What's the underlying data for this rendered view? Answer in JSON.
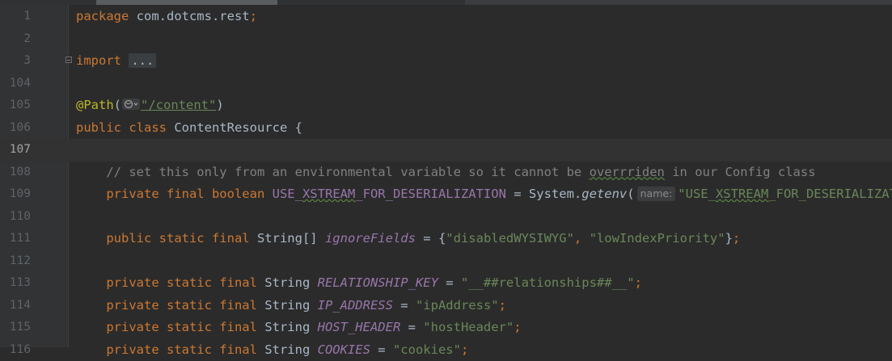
{
  "editor": {
    "lines": [
      {
        "num": "1",
        "tokens": [
          {
            "cls": "kw",
            "t": "package "
          },
          {
            "cls": "punct",
            "t": "com.dotcms.rest"
          },
          {
            "cls": "kw",
            "t": ";"
          }
        ]
      },
      {
        "num": "2",
        "tokens": []
      },
      {
        "num": "3",
        "fold": true,
        "tokens": [
          {
            "cls": "kw",
            "t": "import "
          },
          {
            "cls": "folded",
            "t": "..."
          }
        ]
      },
      {
        "num": "104",
        "tokens": []
      },
      {
        "num": "105",
        "tokens": [
          {
            "cls": "anno",
            "t": "@Path"
          },
          {
            "cls": "punct",
            "t": "("
          },
          {
            "cls": "globe-hint",
            "t": ""
          },
          {
            "cls": "str ul",
            "t": "\"/content\""
          },
          {
            "cls": "punct",
            "t": ")"
          }
        ]
      },
      {
        "num": "106",
        "tokens": [
          {
            "cls": "kw",
            "t": "public class "
          },
          {
            "cls": "punct",
            "t": "ContentResource {"
          }
        ]
      },
      {
        "num": "107",
        "current": true,
        "tokens": []
      },
      {
        "num": "108",
        "tokens": [
          {
            "cls": "comment",
            "t": "    // set this only from an environmental variable so it cannot be "
          },
          {
            "cls": "comment squiggle",
            "t": "overrriden"
          },
          {
            "cls": "comment",
            "t": " in our Config class"
          }
        ]
      },
      {
        "num": "109",
        "tokens": [
          {
            "cls": "kw",
            "t": "    private final boolean "
          },
          {
            "cls": "field",
            "t": "USE_"
          },
          {
            "cls": "field squiggle",
            "t": "XSTREAM"
          },
          {
            "cls": "field",
            "t": "_FOR_DESERIALIZATION"
          },
          {
            "cls": "punct",
            "t": " = System."
          },
          {
            "cls": "method",
            "t": "getenv"
          },
          {
            "cls": "punct",
            "t": "("
          },
          {
            "cls": "hint",
            "t": "name:"
          },
          {
            "cls": "str",
            "t": "\"USE_"
          },
          {
            "cls": "str squiggle",
            "t": "XSTREAM"
          },
          {
            "cls": "str",
            "t": "_FOR_DESERIALIZATION\""
          }
        ]
      },
      {
        "num": "110",
        "tokens": []
      },
      {
        "num": "111",
        "tokens": [
          {
            "cls": "kw",
            "t": "    public static final "
          },
          {
            "cls": "punct",
            "t": "String[] "
          },
          {
            "cls": "const",
            "t": "ignoreFields"
          },
          {
            "cls": "punct",
            "t": " = {"
          },
          {
            "cls": "str",
            "t": "\"disabledWYSIWYG\""
          },
          {
            "cls": "kw",
            "t": ", "
          },
          {
            "cls": "str",
            "t": "\"lowIndexPriority\""
          },
          {
            "cls": "punct",
            "t": "}"
          },
          {
            "cls": "kw",
            "t": ";"
          }
        ]
      },
      {
        "num": "112",
        "tokens": []
      },
      {
        "num": "113",
        "tokens": [
          {
            "cls": "kw",
            "t": "    private static final "
          },
          {
            "cls": "punct",
            "t": "String "
          },
          {
            "cls": "const",
            "t": "RELATIONSHIP_KEY"
          },
          {
            "cls": "punct",
            "t": " = "
          },
          {
            "cls": "str",
            "t": "\"__##relationships##__\""
          },
          {
            "cls": "kw",
            "t": ";"
          }
        ]
      },
      {
        "num": "114",
        "tokens": [
          {
            "cls": "kw",
            "t": "    private static final "
          },
          {
            "cls": "punct",
            "t": "String "
          },
          {
            "cls": "const",
            "t": "IP_ADDRESS"
          },
          {
            "cls": "punct",
            "t": " = "
          },
          {
            "cls": "str",
            "t": "\"ipAddress\""
          },
          {
            "cls": "kw",
            "t": ";"
          }
        ]
      },
      {
        "num": "115",
        "tokens": [
          {
            "cls": "kw",
            "t": "    private static final "
          },
          {
            "cls": "punct",
            "t": "String "
          },
          {
            "cls": "const",
            "t": "HOST_HEADER"
          },
          {
            "cls": "punct",
            "t": " = "
          },
          {
            "cls": "str",
            "t": "\"hostHeader\""
          },
          {
            "cls": "kw",
            "t": ";"
          }
        ]
      },
      {
        "num": "116",
        "tokens": [
          {
            "cls": "kw",
            "t": "    private static final "
          },
          {
            "cls": "punct",
            "t": "String "
          },
          {
            "cls": "const",
            "t": "COOKIES"
          },
          {
            "cls": "punct",
            "t": " = "
          },
          {
            "cls": "str",
            "t": "\"cookies\""
          },
          {
            "cls": "kw",
            "t": ";"
          }
        ]
      }
    ]
  }
}
